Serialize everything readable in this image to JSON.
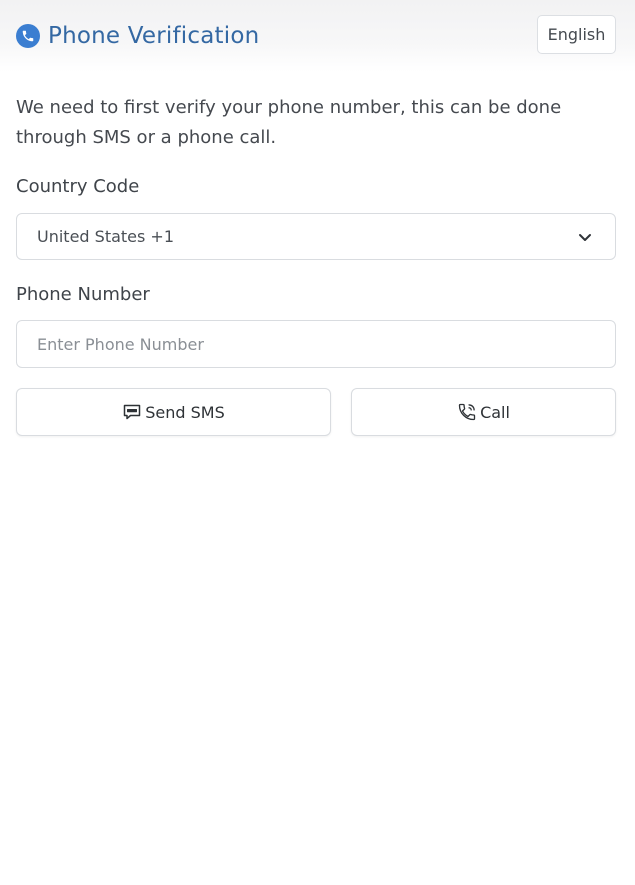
{
  "header": {
    "title": "Phone Verification",
    "language_label": "English"
  },
  "intro": {
    "text": "We need to first verify your phone number, this can be done through SMS or a phone call."
  },
  "country": {
    "label": "Country Code",
    "selected": "United States +1"
  },
  "phone": {
    "label": "Phone Number",
    "placeholder": "Enter Phone Number"
  },
  "actions": {
    "sms_label": "Send SMS",
    "call_label": "Call"
  },
  "colors": {
    "accent": "#3b7ed1",
    "title": "#3468a3",
    "border": "#d9dce0"
  },
  "icons": {
    "brand": "phone-icon",
    "select": "chevron-down-icon",
    "sms": "sms-bubble-icon",
    "call": "phone-call-icon"
  }
}
